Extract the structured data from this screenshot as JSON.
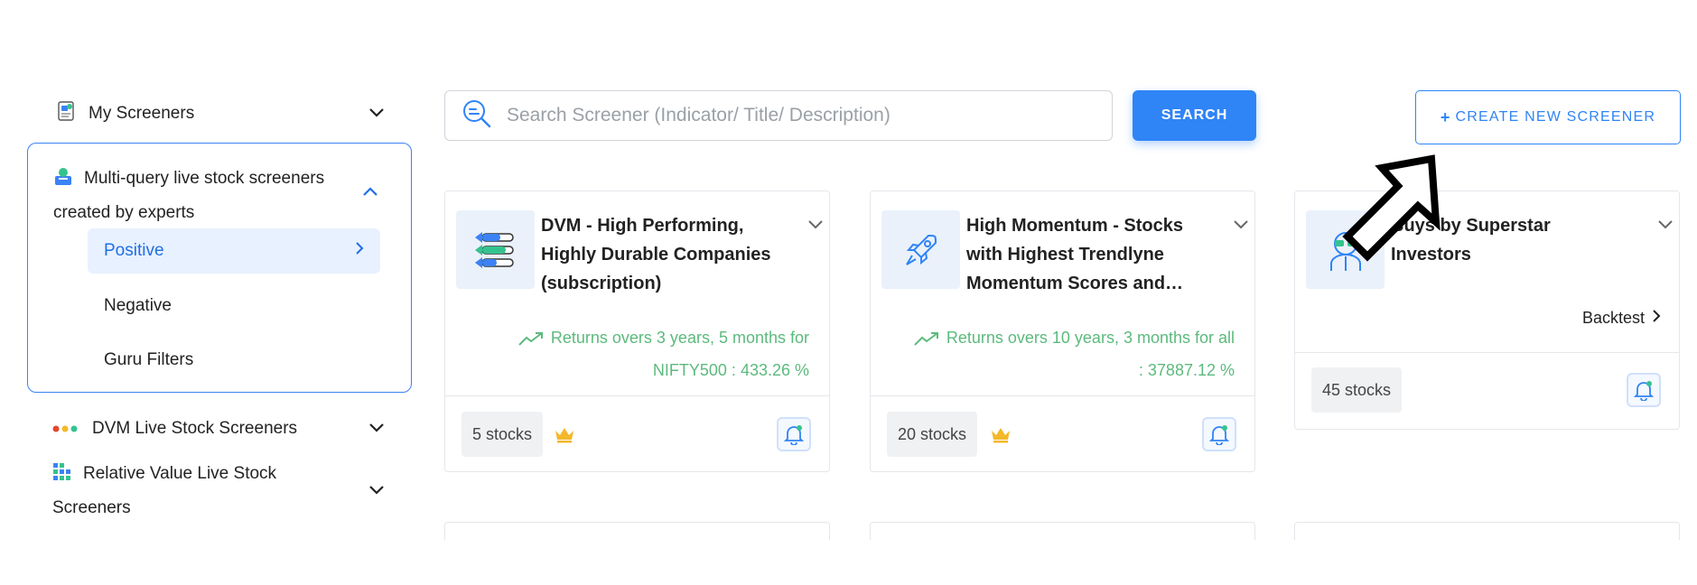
{
  "sidebar": {
    "my_screeners": "My Screeners",
    "experts": {
      "label": "Multi-query live stock screeners created by experts",
      "items": [
        "Positive",
        "Negative",
        "Guru Filters"
      ]
    },
    "dvm": "DVM Live Stock Screeners",
    "relative_value": "Relative Value Live Stock Screeners"
  },
  "search": {
    "placeholder": "Search Screener (Indicator/ Title/ Description)",
    "button": "SEARCH"
  },
  "create_button": "CREATE NEW SCREENER",
  "cards": [
    {
      "title": "DVM - High Performing, Highly Durable Companies (subscription)",
      "returns": "Returns overs 3 years, 5 months for NIFTY500 : 433.26 %",
      "stocks": "5 stocks"
    },
    {
      "title": "High Momentum - Stocks with Highest Trendlyne Momentum Scores and High Momentum",
      "returns": "Returns overs 10 years, 3 months for all : 37887.12 %",
      "stocks": "20 stocks"
    },
    {
      "title": "Buys by Superstar Investors",
      "backtest": "Backtest",
      "stocks": "45 stocks"
    }
  ],
  "colors": {
    "accent": "#2f84f6",
    "returns_green": "#5cba7d",
    "crown_gold": "#f4b82a"
  }
}
